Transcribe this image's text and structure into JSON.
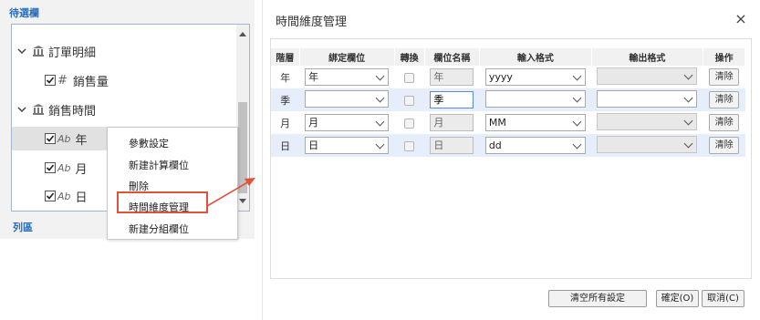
{
  "left_panel": {
    "header": "待選欄",
    "footer": "列區",
    "tree": {
      "order_detail": "訂單明細",
      "sales_qty": "銷售量",
      "sales_time": "銷售時間",
      "year": "年",
      "month": "月",
      "day": "日"
    },
    "type_icon_text": "Ab",
    "hash_icon_text": "#"
  },
  "context_menu": {
    "items": [
      "參數設定",
      "新建計算欄位",
      "刪除",
      "時間維度管理",
      "新建分組欄位"
    ]
  },
  "dialog": {
    "title": "時間維度管理",
    "close_symbol": "×",
    "columns": [
      "階層",
      "綁定欄位",
      "轉換",
      "欄位名稱",
      "輸入格式",
      "輸出格式",
      "操作"
    ],
    "rows": [
      {
        "level": "年",
        "bind": "年",
        "name": "年",
        "input": "yyyy",
        "output": "",
        "action": "清除"
      },
      {
        "level": "季",
        "bind": "",
        "name": "季",
        "input": "",
        "output": "",
        "action": "清除"
      },
      {
        "level": "月",
        "bind": "月",
        "name": "月",
        "input": "MM",
        "output": "",
        "action": "清除"
      },
      {
        "level": "日",
        "bind": "日",
        "name": "日",
        "input": "dd",
        "output": "",
        "action": "清除"
      }
    ],
    "buttons": {
      "clear_all": "清空所有設定",
      "ok": "確定(O)",
      "cancel": "取消(C)"
    }
  },
  "colors": {
    "accent_blue": "#2a6ebb",
    "highlight_red": "#e0533a",
    "row_alt": "#e6eefb"
  }
}
